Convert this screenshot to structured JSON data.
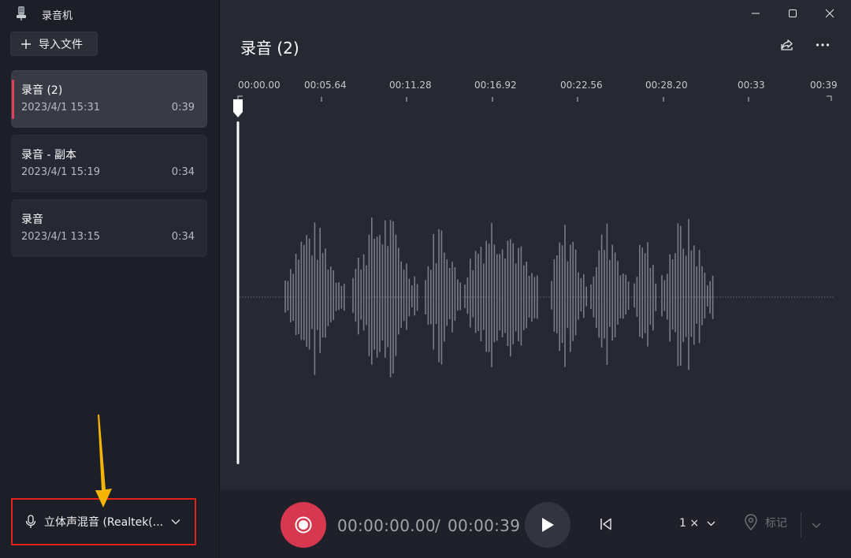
{
  "window": {
    "title": "录音机"
  },
  "sidebar": {
    "import_label": "导入文件",
    "recordings": [
      {
        "name": "录音 (2)",
        "date": "2023/4/1 15:31",
        "duration": "0:39",
        "selected": true
      },
      {
        "name": "录音 - 副本",
        "date": "2023/4/1 15:19",
        "duration": "0:34",
        "selected": false
      },
      {
        "name": "录音",
        "date": "2023/4/1 13:15",
        "duration": "0:34",
        "selected": false
      }
    ],
    "device_label": "立体声混音 (Realtek(..."
  },
  "main": {
    "title": "录音 (2)",
    "timeline_ticks": [
      "00:00.00",
      "00:05.64",
      "00:11.28",
      "00:16.92",
      "00:22.56",
      "00:28.20",
      "00:33",
      "00:39"
    ]
  },
  "controls": {
    "current_time": "00:00:00.00",
    "separator": "/",
    "total_time": "00:00:39",
    "speed_label": "1 ×",
    "mark_label": "标记"
  },
  "colors": {
    "accent_red": "#d8384f",
    "selection_bar": "#e5405a",
    "annotation_box": "#e8221a",
    "annotation_arrow": "#f5b400"
  }
}
